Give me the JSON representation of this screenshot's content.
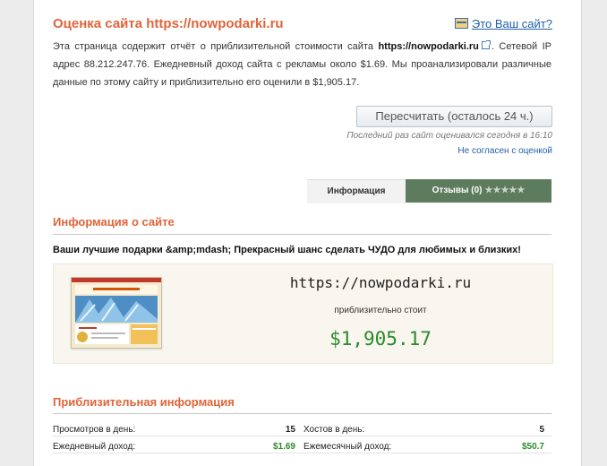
{
  "header": {
    "title": "Оценка сайта https://nowpodarki.ru",
    "own_site_link": "Это Ваш сайт?"
  },
  "description": {
    "part1": "Эта страница содержит отчёт о приблизительной стоимости сайта ",
    "site": "https://nowpodarki.ru",
    "part2": ". Сетевой IP адрес 88.212.247.76. Ежедневный доход сайта с рекламы около $1.69. Мы проанализировали различные данные по этому сайту и приблизительно его оценили в $1,905.17."
  },
  "recalc": {
    "button": "Пересчитать (осталось 24 ч.)",
    "last_checked": "Последний раз сайт оценивался сегодня в 16:10",
    "disagree_link": "Не согласен с оценкой"
  },
  "tabs": {
    "info": "Информация",
    "reviews": "Отзывы (0)",
    "stars": "★★★★★"
  },
  "site_info": {
    "title": "Информация о сайте",
    "tagline": "Ваши лучшие подарки &amp;mdash; Прекрасный шанс сделать ЧУДО для любимых и близких!",
    "url": "https://nowpodarki.ru",
    "caption": "приблизительно стоит",
    "price": "$1,905.17"
  },
  "approx": {
    "title": "Приблизительная информация",
    "rows": [
      {
        "label_left": "Просмотров в день:",
        "value_left": "15",
        "label_right": "Хостов в день:",
        "value_right": "5"
      },
      {
        "label_left": "Ежедневный доход:",
        "value_left": "$1.69",
        "label_right": "Ежемесячный доход:",
        "value_right": "$50.7"
      }
    ]
  },
  "colors": {
    "heading": "#e0643a",
    "link": "#1f5fa8",
    "price_green": "#2c8a2c",
    "tab_green": "#5d7b5d"
  }
}
